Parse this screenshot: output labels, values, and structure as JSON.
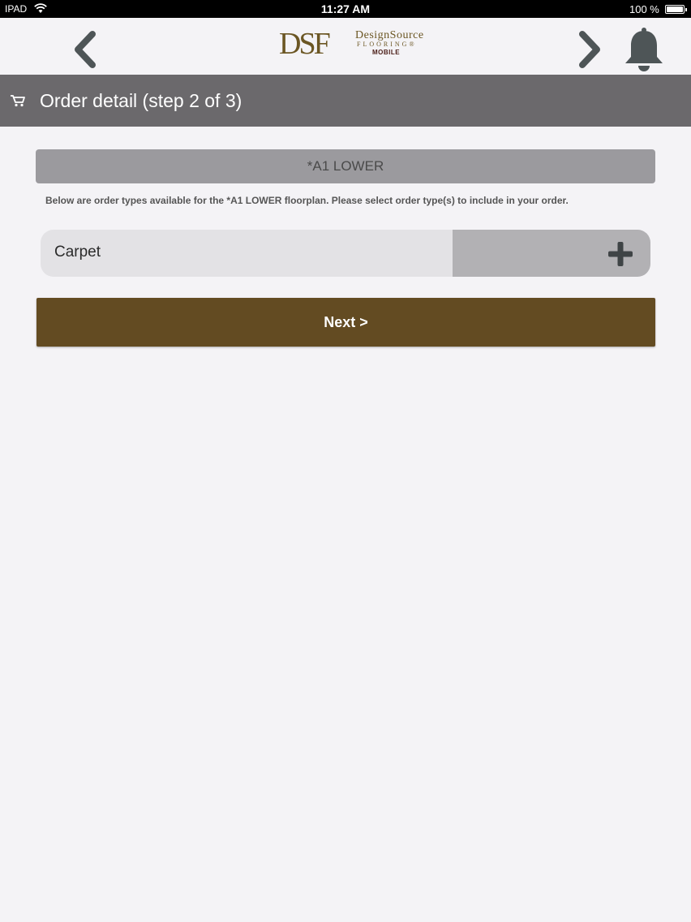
{
  "status_bar": {
    "carrier": "IPAD",
    "time": "11:27 AM",
    "battery": "100 %"
  },
  "nav": {
    "back_icon": "chevron-left-icon",
    "forward_icon": "chevron-right-icon",
    "bell_icon": "bell-icon"
  },
  "logo": {
    "mark": "DSF",
    "name": "DesignSource",
    "sub": "FLOORING®",
    "tagline": "MOBILE"
  },
  "header": {
    "icon": "cart-icon",
    "title": "Order detail (step 2 of 3)"
  },
  "floorplan": {
    "name": "*A1 LOWER",
    "instructions": "Below are order types available for the *A1 LOWER floorplan. Please select order type(s) to include in your order."
  },
  "order_types": [
    {
      "label": "Carpet",
      "action_icon": "plus-icon"
    }
  ],
  "next_label": "Next >",
  "colors": {
    "header_bg": "#6b696c",
    "next_bg": "#634b22",
    "brand": "#6b5623"
  }
}
